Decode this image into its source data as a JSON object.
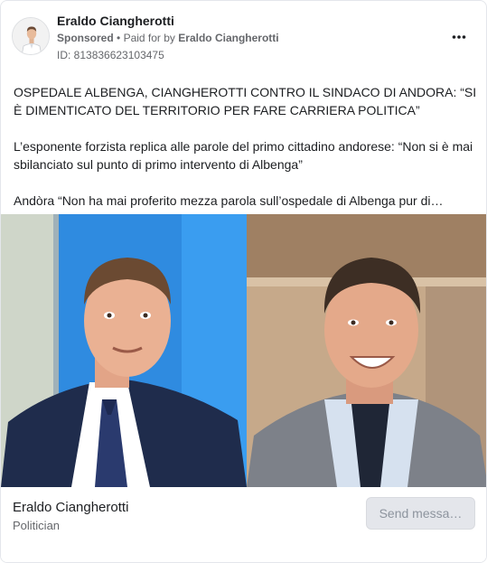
{
  "post": {
    "page_name": "Eraldo Ciangherotti",
    "sponsored_label": "Sponsored",
    "paid_prefix": "Paid for by",
    "paid_by": "Eraldo Ciangherotti",
    "ad_id": "ID: 813836623103475",
    "more_icon": "more-horizontal-icon",
    "paragraphs": [
      "OSPEDALE ALBENGA, CIANGHEROTTI CONTRO IL SINDACO DI ANDORA: “SI È DIMENTICATO DEL TERRITORIO PER FARE CARRIERA POLITICA”",
      "L’esponente forzista replica alle parole del primo cittadino andorese: “Non si è mai sbilanciato sul punto di primo intervento di Albenga”",
      "Andòra “Non ha mai proferito mezza parola sull’ospedale di Albenga pur di…"
    ]
  },
  "footer": {
    "page_name": "Eraldo Ciangherotti",
    "category": "Politician",
    "cta_label": "Send messa…"
  },
  "colors": {
    "text_primary": "#1c1e21",
    "text_secondary": "#65676b",
    "button_bg": "#e4e6eb",
    "button_text": "#8d949e",
    "blue_backdrop": "#2f8be0"
  }
}
